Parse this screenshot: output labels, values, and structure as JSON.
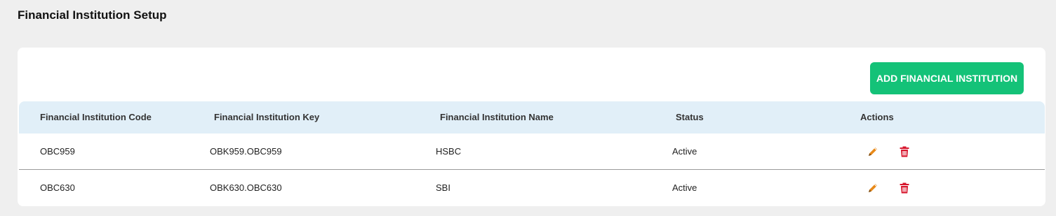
{
  "page": {
    "title": "Financial Institution Setup"
  },
  "toolbar": {
    "add_label": "ADD FINANCIAL INSTITUTION"
  },
  "table": {
    "columns": [
      "Financial Institution Code",
      "Financial Institution Key",
      "Financial Institution Name",
      "Status",
      "Actions"
    ],
    "rows": [
      {
        "code": "OBC959",
        "key": "OBK959.OBC959",
        "name": "HSBC",
        "status": "Active"
      },
      {
        "code": "OBC630",
        "key": "OBK630.OBC630",
        "name": "SBI",
        "status": "Active"
      }
    ]
  },
  "icons": {
    "edit": "pencil-icon",
    "delete": "trash-icon"
  },
  "colors": {
    "accent": "#14c278",
    "header_bg": "#e1eff8",
    "edit_icon": "#e88a1a",
    "delete_icon": "#d7142b",
    "page_bg": "#efefef"
  }
}
